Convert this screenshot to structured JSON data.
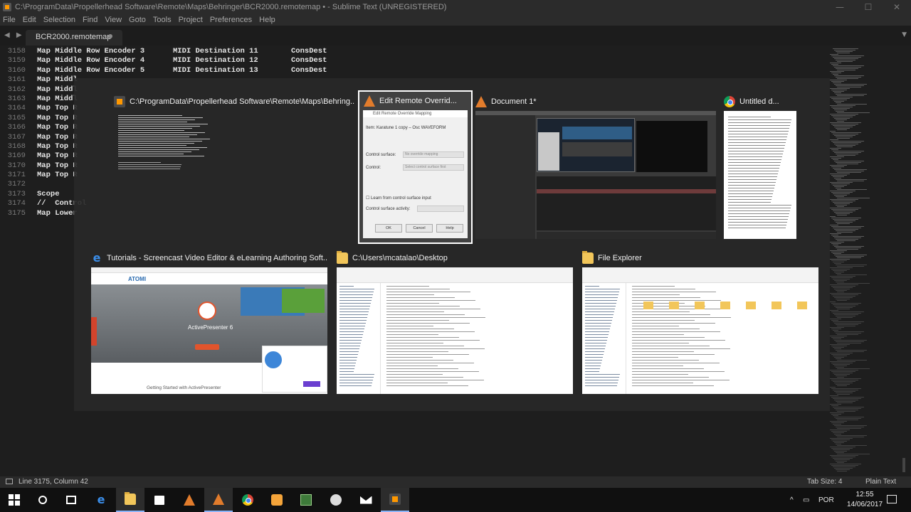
{
  "window": {
    "title": "C:\\ProgramData\\Propellerhead Software\\Remote\\Maps\\Behringer\\BCR2000.remotemap • - Sublime Text (UNREGISTERED)",
    "minimize_glyph": "—",
    "maximize_glyph": "☐",
    "close_glyph": "✕"
  },
  "menu": [
    "File",
    "Edit",
    "Selection",
    "Find",
    "View",
    "Goto",
    "Tools",
    "Project",
    "Preferences",
    "Help"
  ],
  "tabs": {
    "nav_glyph": "◀ ▶",
    "active_label": "BCR2000.remotemap",
    "dropdown_glyph": "▼"
  },
  "editor": {
    "lines": [
      {
        "n": "3158",
        "a": "Map Middle Row Encoder 3",
        "b": "MIDI Destination 11",
        "c": "ConsDest"
      },
      {
        "n": "3159",
        "a": "Map Middle Row Encoder 4",
        "b": "MIDI Destination 12",
        "c": "ConsDest"
      },
      {
        "n": "3160",
        "a": "Map Middle Row Encoder 5",
        "b": "MIDI Destination 13",
        "c": "ConsDest"
      },
      {
        "n": "3161",
        "a": "Map Middl",
        "b": "",
        "c": ""
      },
      {
        "n": "3162",
        "a": "Map Middl",
        "b": "",
        "c": ""
      },
      {
        "n": "3163",
        "a": "Map Middl",
        "b": "",
        "c": ""
      },
      {
        "n": "3164",
        "a": "Map Top R",
        "b": "",
        "c": ""
      },
      {
        "n": "3165",
        "a": "Map Top R",
        "b": "",
        "c": ""
      },
      {
        "n": "3166",
        "a": "Map Top R",
        "b": "",
        "c": ""
      },
      {
        "n": "3167",
        "a": "Map Top R",
        "b": "",
        "c": ""
      },
      {
        "n": "3168",
        "a": "Map Top R",
        "b": "",
        "c": ""
      },
      {
        "n": "3169",
        "a": "Map Top R",
        "b": "",
        "c": ""
      },
      {
        "n": "3170",
        "a": "Map Top R",
        "b": "",
        "c": ""
      },
      {
        "n": "3171",
        "a": "Map Top R",
        "b": "",
        "c": ""
      },
      {
        "n": "3172",
        "a": "",
        "b": "",
        "c": ""
      },
      {
        "n": "3173",
        "a": "Scope",
        "b": "",
        "c": ""
      },
      {
        "n": "3174",
        "a": "//  Control",
        "b": "",
        "c": ""
      },
      {
        "n": "3175",
        "a": "Map Lower",
        "b": "",
        "c": ""
      }
    ]
  },
  "switcher": {
    "windows": [
      {
        "title": "C:\\ProgramData\\Propellerhead Software\\Remote\\Maps\\Behring...",
        "icon": "sublime-icon"
      },
      {
        "title": "Edit Remote Overrid...",
        "icon": "reason-icon"
      },
      {
        "title": "Document 1*",
        "icon": "reason-icon"
      },
      {
        "title": "Untitled d...",
        "icon": "chrome-icon"
      },
      {
        "title": "Tutorials - Screencast Video Editor & eLearning Authoring Soft...",
        "icon": "edge-icon"
      },
      {
        "title": "C:\\Users\\mcatalao\\Desktop",
        "icon": "folder-icon"
      },
      {
        "title": "File Explorer",
        "icon": "folder-icon"
      }
    ],
    "dialog": {
      "title": "Edit Remote Override Mapping",
      "item": "Item: Karatune 1 copy – Osc WAVEFORM",
      "control_surface_label": "Control surface:",
      "control_surface_value": "No override mapping",
      "control_label": "Control:",
      "control_value": "Select control surface first",
      "learn_label": "Learn from control surface input",
      "activity_label": "Control surface activity:",
      "ok": "OK",
      "cancel": "Cancel",
      "help": "Help"
    },
    "web": {
      "logo": "ATOMI",
      "product": "ActivePresenter 6",
      "footer": "Getting Started with ActivePresenter"
    }
  },
  "status": {
    "position": "Line 3175, Column 42",
    "tab_size": "Tab Size: 4",
    "syntax": "Plain Text"
  },
  "taskbar": {
    "lang": "POR",
    "time": "12:55",
    "date": "14/06/2017",
    "tray_glyph": "^"
  },
  "colors": {
    "accent": "#ff9800",
    "selection": "#ffffff",
    "taskbar_active": "#8ab4f8"
  }
}
